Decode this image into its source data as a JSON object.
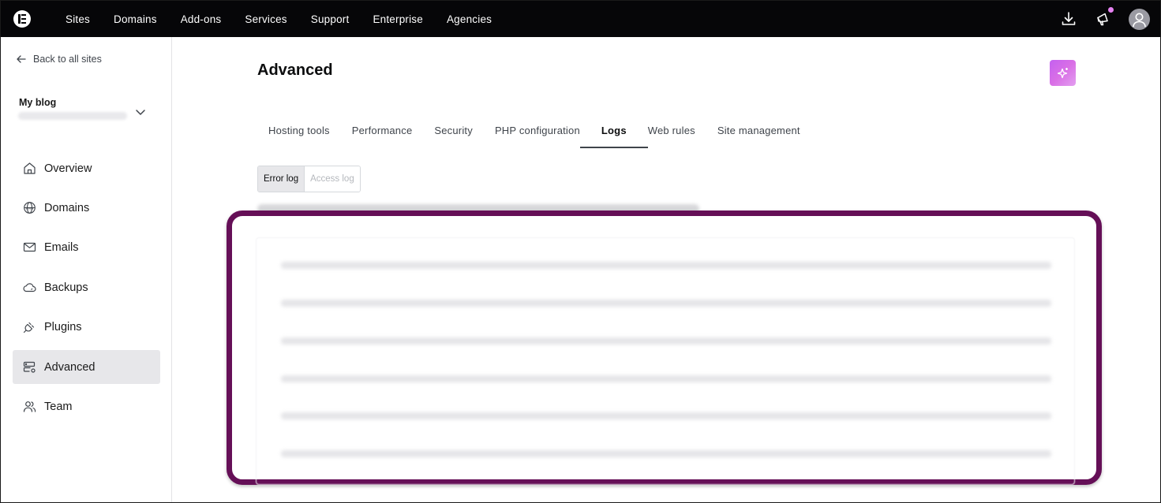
{
  "topbar": {
    "logo_icon": "elementor-logo-icon",
    "nav": [
      "Sites",
      "Domains",
      "Add-ons",
      "Services",
      "Support",
      "Enterprise",
      "Agencies"
    ],
    "icons": [
      "download-icon",
      "announcement-icon",
      "user-avatar-icon"
    ],
    "notification_dot_color": "#e682f2"
  },
  "sidebar": {
    "back_label": "Back to all sites",
    "site_name": "My blog",
    "items": [
      {
        "label": "Overview",
        "icon": "home-icon"
      },
      {
        "label": "Domains",
        "icon": "globe-www-icon"
      },
      {
        "label": "Emails",
        "icon": "envelope-icon"
      },
      {
        "label": "Backups",
        "icon": "cloud-icon"
      },
      {
        "label": "Plugins",
        "icon": "plug-icon"
      },
      {
        "label": "Advanced",
        "icon": "server-settings-icon",
        "active": true
      },
      {
        "label": "Team",
        "icon": "users-icon"
      }
    ]
  },
  "main": {
    "title": "Advanced",
    "ai_button_icon": "sparkle-icon",
    "tabs": [
      {
        "label": "Hosting tools"
      },
      {
        "label": "Performance"
      },
      {
        "label": "Security"
      },
      {
        "label": "PHP configuration"
      },
      {
        "label": "Logs",
        "active": true
      },
      {
        "label": "Web rules"
      },
      {
        "label": "Site management"
      }
    ],
    "log_toggle": {
      "error_log": "Error log",
      "access_log": "Access log",
      "selected": "Error log"
    }
  },
  "colors": {
    "topbar_bg": "#060608",
    "highlight_border": "#650f57",
    "ai_gradient_start": "#c460f0",
    "active_item_bg": "#e7e7ea"
  }
}
